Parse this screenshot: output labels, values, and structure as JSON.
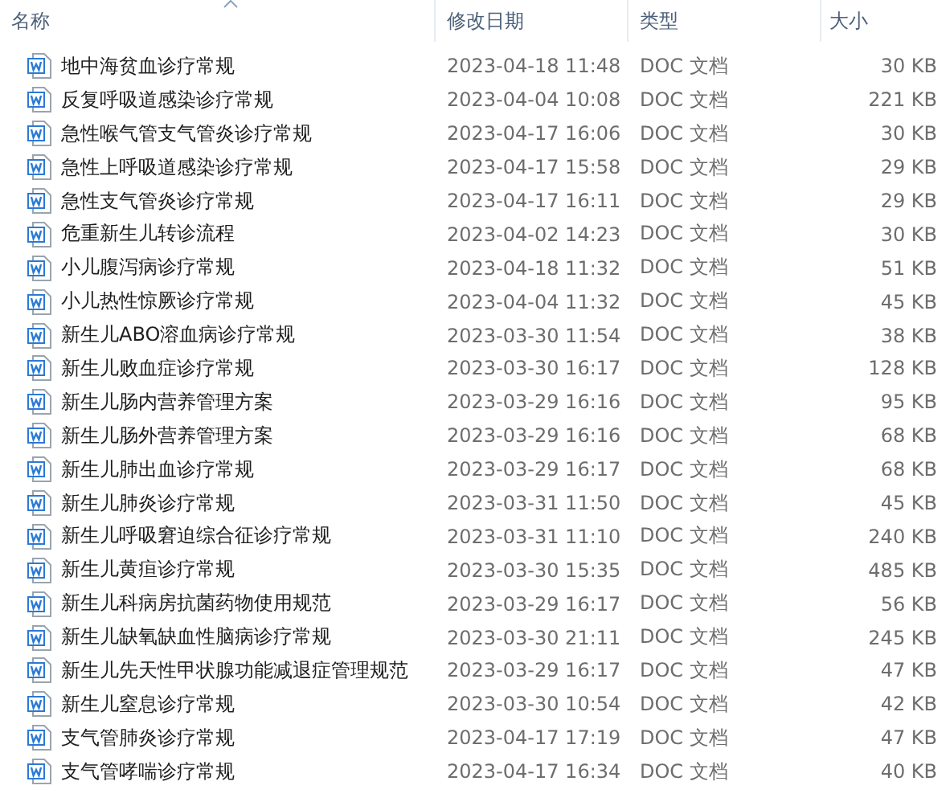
{
  "columns": [
    {
      "label": "名称",
      "sorted": true
    },
    {
      "label": "修改日期",
      "sorted": false
    },
    {
      "label": "类型",
      "sorted": false
    },
    {
      "label": "大小",
      "sorted": false
    }
  ],
  "files": [
    {
      "name": "地中海贫血诊疗常规",
      "modified": "2023-04-18 11:48",
      "type": "DOC 文档",
      "size": "30 KB"
    },
    {
      "name": "反复呼吸道感染诊疗常规",
      "modified": "2023-04-04 10:08",
      "type": "DOC 文档",
      "size": "221 KB"
    },
    {
      "name": "急性喉气管支气管炎诊疗常规",
      "modified": "2023-04-17 16:06",
      "type": "DOC 文档",
      "size": "30 KB"
    },
    {
      "name": "急性上呼吸道感染诊疗常规",
      "modified": "2023-04-17 15:58",
      "type": "DOC 文档",
      "size": "29 KB"
    },
    {
      "name": "急性支气管炎诊疗常规",
      "modified": "2023-04-17 16:11",
      "type": "DOC 文档",
      "size": "29 KB"
    },
    {
      "name": "危重新生儿转诊流程",
      "modified": "2023-04-02 14:23",
      "type": "DOC 文档",
      "size": "30 KB"
    },
    {
      "name": "小儿腹泻病诊疗常规",
      "modified": "2023-04-18 11:32",
      "type": "DOC 文档",
      "size": "51 KB"
    },
    {
      "name": "小儿热性惊厥诊疗常规",
      "modified": "2023-04-04 11:32",
      "type": "DOC 文档",
      "size": "45 KB"
    },
    {
      "name": "新生儿ABO溶血病诊疗常规",
      "modified": "2023-03-30 11:54",
      "type": "DOC 文档",
      "size": "38 KB"
    },
    {
      "name": "新生儿败血症诊疗常规",
      "modified": "2023-03-30 16:17",
      "type": "DOC 文档",
      "size": "128 KB"
    },
    {
      "name": "新生儿肠内营养管理方案",
      "modified": "2023-03-29 16:16",
      "type": "DOC 文档",
      "size": "95 KB"
    },
    {
      "name": "新生儿肠外营养管理方案",
      "modified": "2023-03-29 16:16",
      "type": "DOC 文档",
      "size": "68 KB"
    },
    {
      "name": "新生儿肺出血诊疗常规",
      "modified": "2023-03-29 16:17",
      "type": "DOC 文档",
      "size": "68 KB"
    },
    {
      "name": "新生儿肺炎诊疗常规",
      "modified": "2023-03-31 11:50",
      "type": "DOC 文档",
      "size": "45 KB"
    },
    {
      "name": "新生儿呼吸窘迫综合征诊疗常规",
      "modified": "2023-03-31 11:10",
      "type": "DOC 文档",
      "size": "240 KB"
    },
    {
      "name": "新生儿黄疸诊疗常规",
      "modified": "2023-03-30 15:35",
      "type": "DOC 文档",
      "size": "485 KB"
    },
    {
      "name": "新生儿科病房抗菌药物使用规范",
      "modified": "2023-03-29 16:17",
      "type": "DOC 文档",
      "size": "56 KB"
    },
    {
      "name": "新生儿缺氧缺血性脑病诊疗常规",
      "modified": "2023-03-30 21:11",
      "type": "DOC 文档",
      "size": "245 KB"
    },
    {
      "name": "新生儿先天性甲状腺功能减退症管理规范",
      "modified": "2023-03-29 16:17",
      "type": "DOC 文档",
      "size": "47 KB"
    },
    {
      "name": "新生儿窒息诊疗常规",
      "modified": "2023-03-30 10:54",
      "type": "DOC 文档",
      "size": "42 KB"
    },
    {
      "name": "支气管肺炎诊疗常规",
      "modified": "2023-04-17 17:19",
      "type": "DOC 文档",
      "size": "47 KB"
    },
    {
      "name": "支气管哮喘诊疗常规",
      "modified": "2023-04-17 16:34",
      "type": "DOC 文档",
      "size": "40 KB"
    }
  ]
}
